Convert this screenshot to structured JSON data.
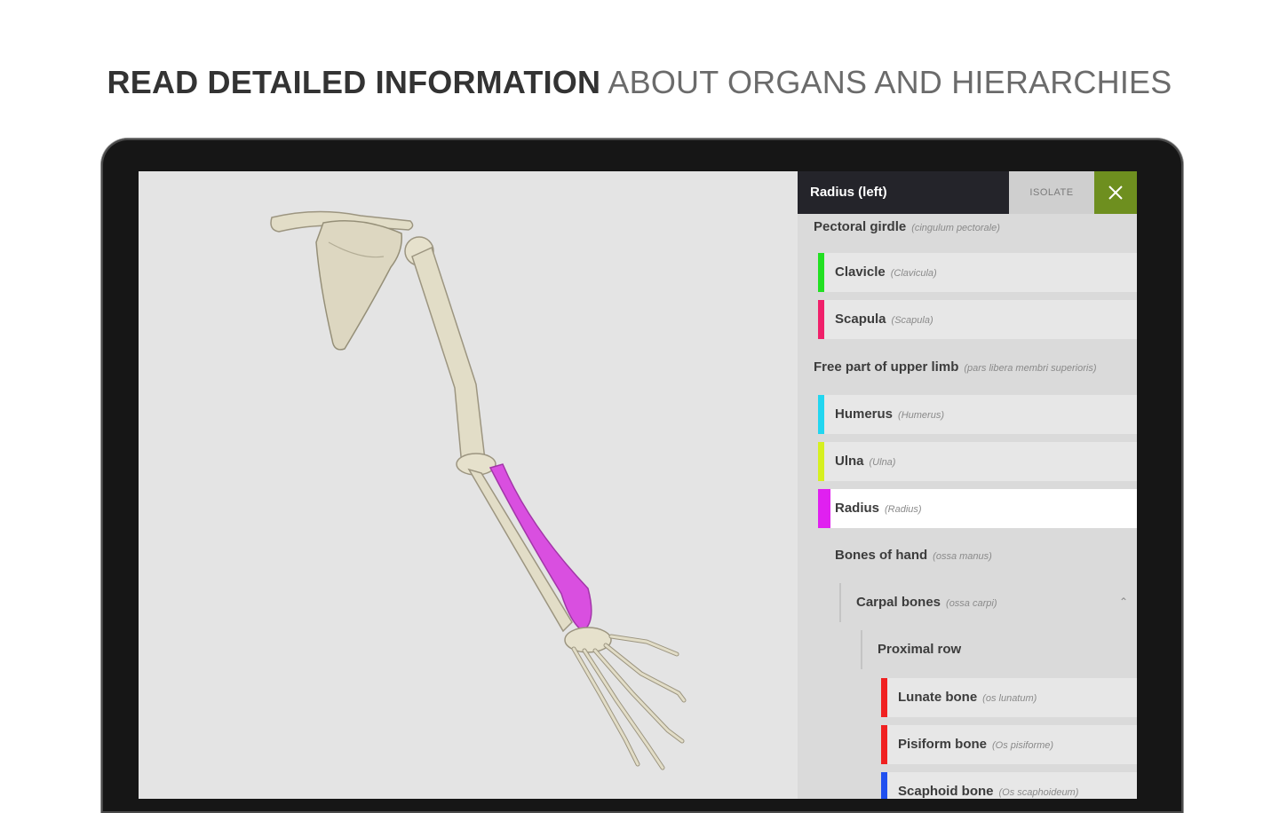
{
  "headline": {
    "bold": "READ DETAILED INFORMATION",
    "light": "ABOUT ORGANS AND HIERARCHIES"
  },
  "panel": {
    "title": "Radius (left)",
    "isolate_label": "ISOLATE",
    "close_icon": "close-icon",
    "groups": [
      {
        "label": "Pectoral girdle",
        "latin": "(cingulum pectorale)"
      },
      {
        "label": "Free part of upper limb",
        "latin": "(pars libera membri superioris)"
      },
      {
        "label": "Bones of hand",
        "latin": "(ossa manus)"
      },
      {
        "label": "Carpal bones",
        "latin": "(ossa carpi)"
      },
      {
        "label": "Proximal row",
        "latin": ""
      }
    ],
    "items": [
      {
        "label": "Clavicle",
        "latin": "(Clavicula)",
        "color": "#22e022"
      },
      {
        "label": "Scapula",
        "latin": "(Scapula)",
        "color": "#f0206a"
      },
      {
        "label": "Humerus",
        "latin": "(Humerus)",
        "color": "#22d6f0"
      },
      {
        "label": "Ulna",
        "latin": "(Ulna)",
        "color": "#d6f020"
      },
      {
        "label": "Radius",
        "latin": "(Radius)",
        "color": "#e020f0",
        "selected": true
      },
      {
        "label": "Lunate bone",
        "latin": "(os lunatum)",
        "color": "#f02020"
      },
      {
        "label": "Pisiform bone",
        "latin": "(Os pisiforme)",
        "color": "#f02020"
      },
      {
        "label": "Scaphoid bone",
        "latin": "(Os scaphoideum)",
        "color": "#2050f0"
      }
    ]
  },
  "colors": {
    "highlight": "#d94fe0",
    "bone": "#e2ddc7",
    "accent": "#6e8f1f"
  }
}
